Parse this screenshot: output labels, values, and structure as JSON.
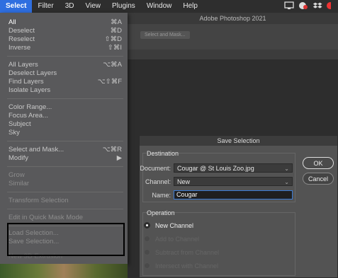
{
  "menubar": {
    "items": [
      "Select",
      "Filter",
      "3D",
      "View",
      "Plugins",
      "Window",
      "Help"
    ]
  },
  "app": {
    "title": "Adobe Photoshop 2021",
    "options_bar_button": "Select and Mask..."
  },
  "select_menu": {
    "items": [
      {
        "label": "All",
        "shortcut": "⌘A"
      },
      {
        "label": "Deselect",
        "shortcut": "⌘D"
      },
      {
        "label": "Reselect",
        "shortcut": "⇧⌘D"
      },
      {
        "label": "Inverse",
        "shortcut": "⇧⌘I"
      },
      {
        "label": "All Layers",
        "shortcut": "⌥⌘A"
      },
      {
        "label": "Deselect Layers",
        "shortcut": ""
      },
      {
        "label": "Find Layers",
        "shortcut": "⌥⇧⌘F"
      },
      {
        "label": "Isolate Layers",
        "shortcut": ""
      },
      {
        "label": "Color Range...",
        "shortcut": ""
      },
      {
        "label": "Focus Area...",
        "shortcut": ""
      },
      {
        "label": "Subject",
        "shortcut": ""
      },
      {
        "label": "Sky",
        "shortcut": ""
      },
      {
        "label": "Select and Mask...",
        "shortcut": "⌥⌘R"
      },
      {
        "label": "Modify",
        "shortcut": "▶"
      },
      {
        "label": "Grow",
        "shortcut": ""
      },
      {
        "label": "Similar",
        "shortcut": ""
      },
      {
        "label": "Transform Selection",
        "shortcut": ""
      },
      {
        "label": "Edit in Quick Mask Mode",
        "shortcut": ""
      },
      {
        "label": "Load Selection...",
        "shortcut": ""
      },
      {
        "label": "Save Selection...",
        "shortcut": ""
      },
      {
        "label": "New 3D Extrusion",
        "shortcut": ""
      }
    ]
  },
  "dialog": {
    "title": "Save Selection",
    "destination_label": "Destination",
    "document_label": "Document:",
    "document_value": "Cougar @ St Louis Zoo.jpg",
    "channel_label": "Channel:",
    "channel_value": "New",
    "name_label": "Name:",
    "name_value": "Cougar",
    "operation_label": "Operation",
    "operations": [
      "New Channel",
      "Add to Channel",
      "Subtract from Channel",
      "Intersect with Channel"
    ],
    "ok_label": "OK",
    "cancel_label": "Cancel"
  },
  "colors": {
    "menu_highlight": "#2f6fe0",
    "focus_ring": "#3a7bd5"
  }
}
